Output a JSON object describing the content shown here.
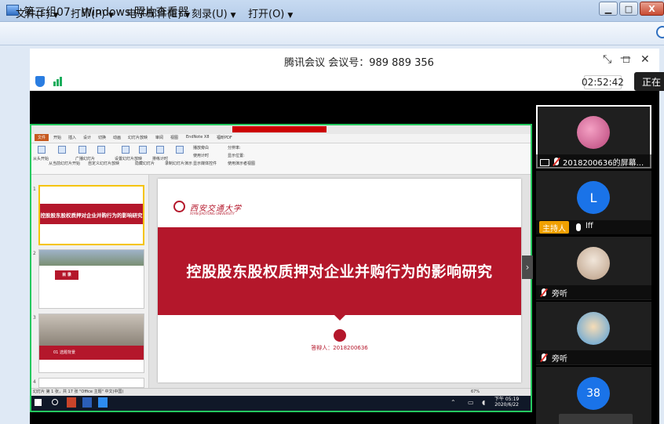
{
  "photo_viewer": {
    "title": "第三组07 - Windows 照片查看器",
    "menu": [
      {
        "label": "文件(F)"
      },
      {
        "label": "打印(P)"
      },
      {
        "label": "电子邮件(E)"
      },
      {
        "label": "刻录(U)"
      },
      {
        "label": "打开(O)"
      }
    ],
    "menu_arrow": "▼",
    "minimize_glyph": "▁",
    "maximize_glyph": "□",
    "close_glyph": "X"
  },
  "meeting": {
    "title": "腾讯会议 会议号：989 889 356",
    "timer": "02:52:42",
    "talking_label": "正在",
    "ctrl_compact": "⤡",
    "ctrl_minimize": "—",
    "ctrl_maximize": "☐",
    "ctrl_close": "✕"
  },
  "ppt": {
    "tabs": [
      "文件",
      "开始",
      "插入",
      "设计",
      "切换",
      "动画",
      "幻灯片放映",
      "审阅",
      "视图",
      "EndNote X8",
      "福昕PDF"
    ],
    "ribbon_groups": [
      "从头开始",
      "从当前幻灯片开始",
      "广播幻灯片",
      "自定义幻灯片放映",
      "设置幻灯片放映",
      "隐藏幻灯片",
      "排练计时",
      "录制幻灯片演示"
    ],
    "ribbon_checks": [
      "播放旁白",
      "使用计时",
      "显示媒体控件"
    ],
    "ribbon_monitor": [
      "分辨率:",
      "显示位置:",
      "使用演示者视图"
    ],
    "thumbnails": [
      {
        "num": "1",
        "text": "控股股东股权质押对企业并购行为的影响研究"
      },
      {
        "num": "2",
        "text": "目 录"
      },
      {
        "num": "3",
        "text": "01 选题背景"
      },
      {
        "num": "4",
        "text": ""
      }
    ],
    "slide": {
      "logo_text": "西安交通大学",
      "logo_sub": "XI'AN JIAOTONG UNIVERSITY",
      "title": "控股股东股权质押对企业并购行为的影响研究",
      "presenter": "答辩人：2018200636"
    },
    "status_bar": "幻灯片 第 1 张，共 17 张  \"Office 主题\"  中文(中国)",
    "zoom": "67%",
    "tray_time": "下午 05:19",
    "tray_date": "2020/6/22",
    "nav_arrow": "›"
  },
  "participants": [
    {
      "name": "2018200636的屏幕...",
      "avatar_type": "image",
      "active": true
    },
    {
      "name": "lff",
      "avatar_letter": "L",
      "host_label": "主持人"
    },
    {
      "name": "旁听",
      "avatar_type": "image"
    },
    {
      "name": "旁听",
      "avatar_type": "image"
    },
    {
      "name": "",
      "avatar_letter": "38"
    }
  ],
  "colors": {
    "slide_red": "#b4172b",
    "share_border": "#25c95f",
    "avatar_blue": "#1a73e8",
    "host_orange": "#f0a000"
  }
}
